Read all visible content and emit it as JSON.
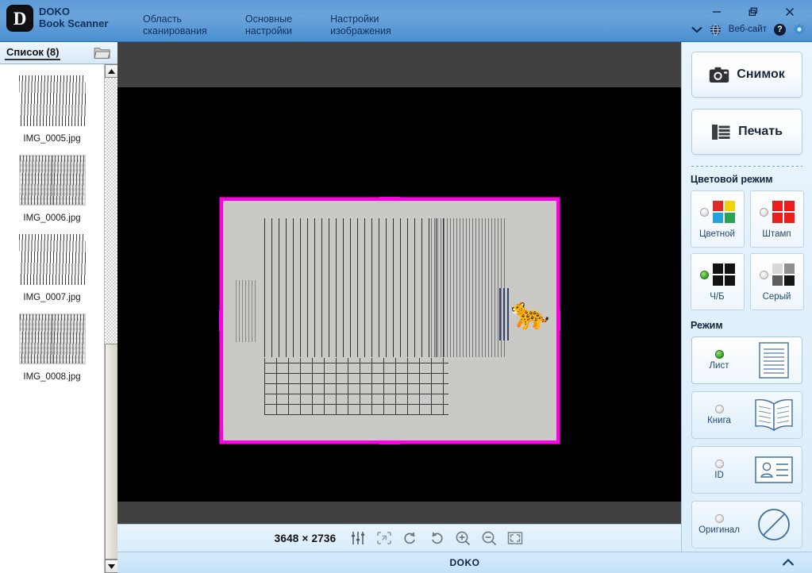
{
  "app": {
    "logo_letter": "D",
    "brand_line1": "DOKO",
    "brand_line2": "Book Scanner"
  },
  "titlebar": {
    "tabs": [
      {
        "label": "Область\nсканирования",
        "name": "tab-scan-area"
      },
      {
        "label": "Основные\nнастройки",
        "name": "tab-main-settings"
      },
      {
        "label": "Настройки\nизображения",
        "name": "tab-image-settings"
      }
    ],
    "window_controls": {
      "minimize": "—",
      "restore": "❐",
      "close": "✕"
    },
    "website_label": "Веб-сайт",
    "help_label": "?"
  },
  "sidebar": {
    "header_title": "Список (8)",
    "folder_icon": "folder-icon",
    "items": [
      {
        "label": "IMG_0005.jpg",
        "style": "bw"
      },
      {
        "label": "IMG_0006.jpg",
        "style": "gray"
      },
      {
        "label": "IMG_0007.jpg",
        "style": "bw"
      },
      {
        "label": "IMG_0008.jpg",
        "style": "gray"
      }
    ]
  },
  "viewer": {
    "selection_color": "#ff00e6",
    "background": "#000000",
    "band_color": "#414141"
  },
  "bottombar": {
    "resolution": "3648 × 2736",
    "tools": [
      {
        "name": "adjust-sliders-icon",
        "title": "sliders"
      },
      {
        "name": "crop-icon",
        "title": "crop"
      },
      {
        "name": "rotate-left-icon",
        "title": "rotate left"
      },
      {
        "name": "rotate-right-icon",
        "title": "rotate right"
      },
      {
        "name": "zoom-in-icon",
        "title": "zoom in"
      },
      {
        "name": "zoom-out-icon",
        "title": "zoom out"
      },
      {
        "name": "fit-screen-icon",
        "title": "fit to screen"
      }
    ]
  },
  "statusbar": {
    "text": "DOKO",
    "chevron": "chevron-up-icon"
  },
  "rightpanel": {
    "snapshot_label": "Снимок",
    "print_label": "Печать",
    "color_mode_title": "Цветовой режим",
    "color_modes": [
      {
        "label": "Цветной",
        "selected": false,
        "colors": [
          "#e02b2b",
          "#f5d10a",
          "#22a2de",
          "#2aa44f"
        ]
      },
      {
        "label": "Штамп",
        "selected": false,
        "colors": [
          "#ee1c1c",
          "#ee1c1c",
          "#ee1c1c",
          "#ee1c1c"
        ]
      },
      {
        "label": "Ч/Б",
        "selected": true,
        "colors": [
          "#121212",
          "#121212",
          "#121212",
          "#121212"
        ]
      },
      {
        "label": "Серый",
        "selected": false,
        "colors": [
          "#d8d8d8",
          "#8f8f8f",
          "#5d5d5d",
          "#151515"
        ]
      }
    ],
    "mode_title": "Режим",
    "modes": [
      {
        "label": "Лист",
        "selected": true,
        "icon": "sheet-icon"
      },
      {
        "label": "Книга",
        "selected": false,
        "icon": "book-icon"
      },
      {
        "label": "ID",
        "selected": false,
        "icon": "id-card-icon"
      },
      {
        "label": "Оригинал",
        "selected": false,
        "icon": "original-none-icon"
      }
    ]
  }
}
